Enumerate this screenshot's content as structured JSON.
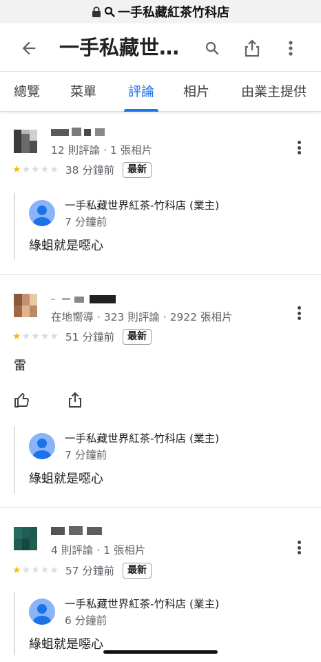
{
  "browser": {
    "url_text": "一手私藏紅茶竹科店"
  },
  "header": {
    "title": "一手私藏世…"
  },
  "tabs": [
    {
      "label": "總覽"
    },
    {
      "label": "菜單"
    },
    {
      "label": "評論",
      "active": true
    },
    {
      "label": "相片"
    },
    {
      "label": "由業主提供"
    }
  ],
  "reviews": [
    {
      "reviewer_meta": "12 則評論 · 1 張相片",
      "rating": 1,
      "time": "38 分鐘前",
      "badge": "最新",
      "text": "",
      "owner_reply": {
        "name": "一手私藏世界紅茶-竹科店 (業主)",
        "time": "7 分鐘前",
        "text": "綠蛆就是噁心"
      }
    },
    {
      "reviewer_meta": "在地嚮導 · 323 則評論 · 2922 張相片",
      "rating": 1,
      "time": "51 分鐘前",
      "badge": "最新",
      "text": "雷",
      "owner_reply": {
        "name": "一手私藏世界紅茶-竹科店 (業主)",
        "time": "7 分鐘前",
        "text": "綠蛆就是噁心"
      }
    },
    {
      "reviewer_meta": "4 則評論 · 1 張相片",
      "rating": 1,
      "time": "57 分鐘前",
      "badge": "最新",
      "text": "",
      "owner_reply": {
        "name": "一手私藏世界紅茶-竹科店 (業主)",
        "time": "6 分鐘前",
        "text": "綠蛆就是噁心"
      }
    }
  ],
  "colors": {
    "accent": "#1a73e8",
    "star_filled": "#fbbc04",
    "star_empty": "#dadce0"
  },
  "icons": [
    "lock-icon",
    "search-icon",
    "back-arrow-icon",
    "share-icon",
    "more-vert-icon",
    "thumb-up-icon",
    "avatar-icon"
  ]
}
